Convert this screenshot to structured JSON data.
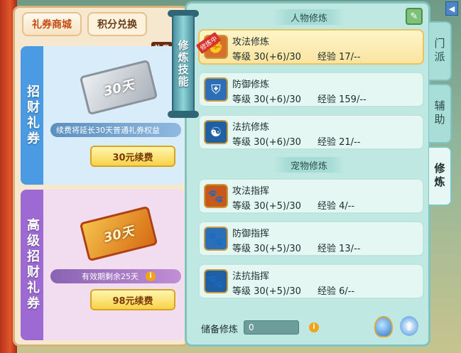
{
  "shop": {
    "tabs": [
      {
        "label": "礼券商城",
        "active": true
      },
      {
        "label": "积分兑换",
        "active": false
      }
    ],
    "badge": "礼券",
    "cards": [
      {
        "title": "招财礼券",
        "ticket_text": "30天",
        "note": "续费将延长30天普通礼券权益",
        "button": "30元续费"
      },
      {
        "title": "高级招财礼券",
        "ticket_text": "30天",
        "note": "有效期剩余25天",
        "button": "98元续费"
      }
    ]
  },
  "ribbon": {
    "label": "修炼技能"
  },
  "panel": {
    "character_section": "人物修炼",
    "pet_section": "宠物修炼",
    "character_skills": [
      {
        "name": "攻法修炼",
        "level": "等级  30(+6)/30",
        "exp": "经验  17/--",
        "tag": "修炼中",
        "selected": true,
        "icon": "fist-icon"
      },
      {
        "name": "防御修炼",
        "level": "等级  30(+6)/30",
        "exp": "经验  159/--",
        "tag": "",
        "selected": false,
        "icon": "shield-icon"
      },
      {
        "name": "法抗修炼",
        "level": "等级  30(+6)/30",
        "exp": "经验  21/--",
        "tag": "",
        "selected": false,
        "icon": "yin-yang-shield-icon"
      }
    ],
    "pet_skills": [
      {
        "name": "攻法指挥",
        "level": "等级  30(+5)/30",
        "exp": "经验  4/--",
        "icon": "paw-attack-icon"
      },
      {
        "name": "防御指挥",
        "level": "等级  30(+5)/30",
        "exp": "经验  13/--",
        "icon": "paw-defense-icon"
      },
      {
        "name": "法抗指挥",
        "level": "等级  30(+5)/30",
        "exp": "经验  6/--",
        "icon": "paw-resist-icon"
      }
    ],
    "reserve_label": "储备修炼",
    "reserve_value": "0"
  },
  "side_tabs": [
    {
      "label": "门派",
      "active": false
    },
    {
      "label": "辅助",
      "active": false
    },
    {
      "label": "修炼",
      "active": true
    }
  ],
  "colors": {
    "panel": "#bfe8e2",
    "selected_row": "#f9e4a0",
    "accent": "#d8322b"
  }
}
